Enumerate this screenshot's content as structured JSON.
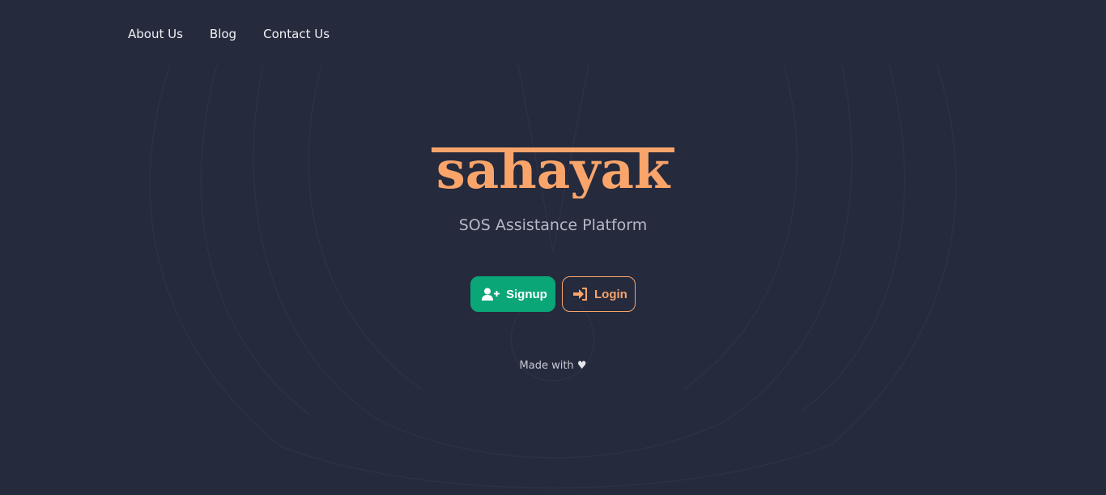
{
  "nav": {
    "items": [
      {
        "label": "About Us"
      },
      {
        "label": "Blog"
      },
      {
        "label": "Contact Us"
      }
    ]
  },
  "brand": {
    "name": "sahayak",
    "tagline": "SOS Assistance Platform",
    "color": "#f9a46a"
  },
  "actions": {
    "signup_label": "Signup",
    "login_label": "Login",
    "signup_icon": "user-plus-icon",
    "login_icon": "sign-in-icon",
    "signup_color": "#0aa678",
    "login_color": "#f9a46a"
  },
  "footer": {
    "made_with": "Made with",
    "heart": "♥"
  },
  "theme": {
    "background": "#252a3d"
  }
}
